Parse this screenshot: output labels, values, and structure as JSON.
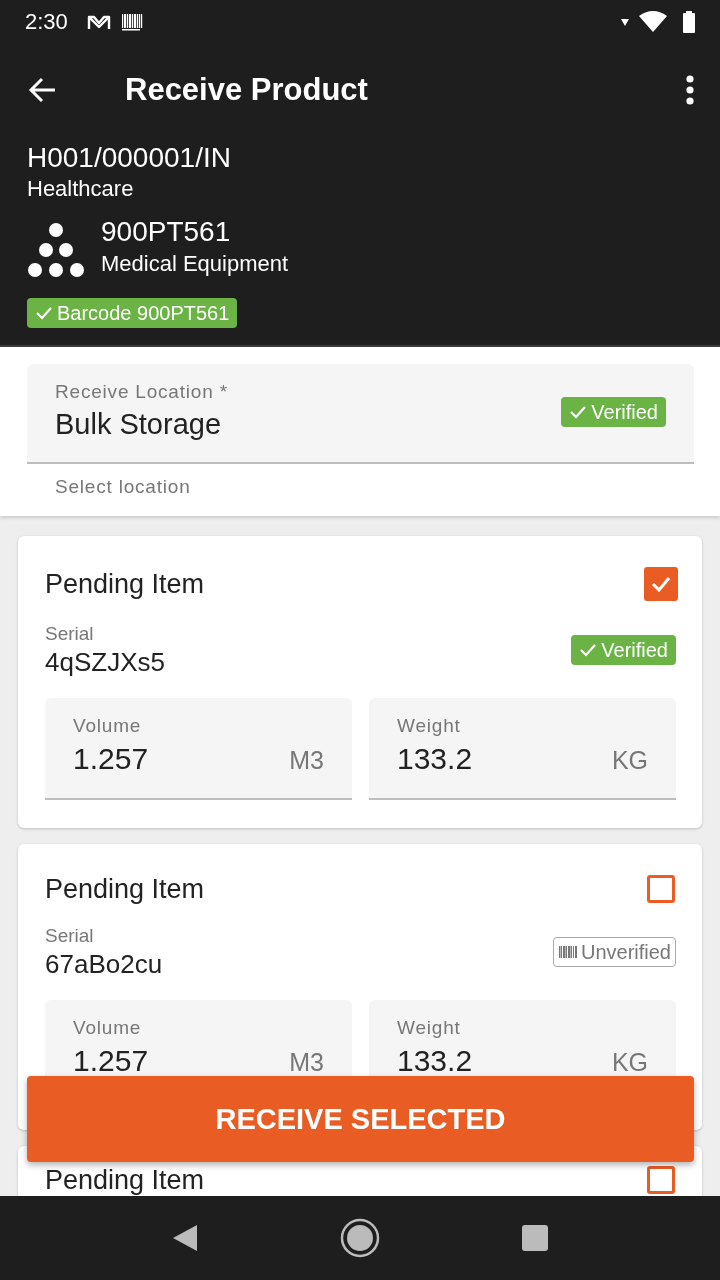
{
  "status_bar": {
    "time": "2:30"
  },
  "app_bar": {
    "title": "Receive Product"
  },
  "order": {
    "number": "H001/000001/IN",
    "department": "Healthcare"
  },
  "product": {
    "code": "900PT561",
    "category": "Medical Equipment",
    "barcode_badge": "Barcode 900PT561"
  },
  "location_field": {
    "label": "Receive Location *",
    "value": "Bulk Storage",
    "badge": {
      "kind": "verified",
      "label": "Verified"
    },
    "helper": "Select location"
  },
  "items": [
    {
      "title": "Pending Item",
      "checked": true,
      "serial_label": "Serial",
      "serial": "4qSZJXs5",
      "badge": {
        "kind": "verified",
        "label": "Verified"
      },
      "fields": [
        {
          "label": "Volume",
          "value": "1.257",
          "unit": "M3"
        },
        {
          "label": "Weight",
          "value": "133.2",
          "unit": "KG"
        }
      ]
    },
    {
      "title": "Pending Item",
      "checked": false,
      "serial_label": "Serial",
      "serial": "67aBo2cu",
      "badge": {
        "kind": "unverified",
        "label": "Unverified"
      },
      "fields": [
        {
          "label": "Volume",
          "value": "1.257",
          "unit": "M3"
        },
        {
          "label": "Weight",
          "value": "133.2",
          "unit": "KG"
        }
      ]
    },
    {
      "title": "Pending Item",
      "checked": false
    }
  ],
  "action_button": {
    "label": "RECEIVE SELECTED"
  }
}
